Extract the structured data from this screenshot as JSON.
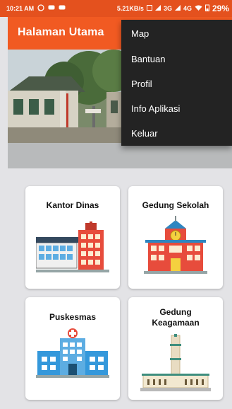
{
  "status_bar": {
    "time": "10:21 AM",
    "net_speed": "5.21KB/s",
    "sim1": "3G",
    "sim2": "4G",
    "battery": "29%"
  },
  "appbar": {
    "title": "Halaman Utama"
  },
  "menu": {
    "items": [
      "Map",
      "Bantuan",
      "Profil",
      "Info Aplikasi",
      "Keluar"
    ]
  },
  "cards": [
    {
      "label": "Kantor Dinas",
      "icon": "office-building-icon"
    },
    {
      "label": "Gedung Sekolah",
      "icon": "school-building-icon"
    },
    {
      "label": "Puskesmas",
      "icon": "hospital-icon"
    },
    {
      "label": "Gedung Keagamaan",
      "icon": "mosque-icon"
    }
  ],
  "colors": {
    "status_bar": "#e4511e",
    "app_bar": "#f15a22",
    "menu_bg": "#232323",
    "background": "#e3e3e6"
  }
}
